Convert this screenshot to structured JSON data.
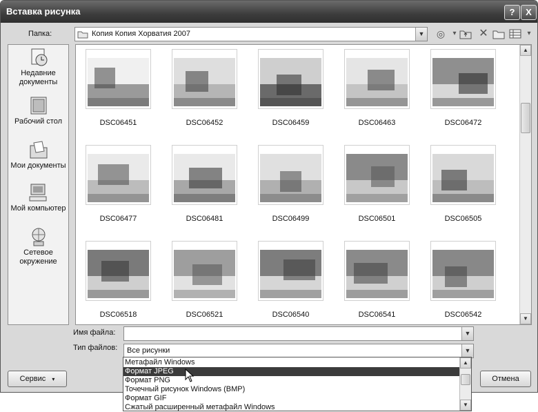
{
  "window": {
    "title": "Вставка рисунка",
    "help_button": "?",
    "close_button": "X"
  },
  "folder": {
    "label": "Папка:",
    "value": "Копия Копия Хорватия 2007"
  },
  "places": [
    {
      "id": "recent",
      "label": "Недавние документы",
      "icon": "recent-documents-icon"
    },
    {
      "id": "desktop",
      "label": "Рабочий стол",
      "icon": "desktop-icon"
    },
    {
      "id": "my-documents",
      "label": "Мои документы",
      "icon": "my-documents-icon"
    },
    {
      "id": "my-computer",
      "label": "Мой компьютер",
      "icon": "my-computer-icon"
    },
    {
      "id": "network",
      "label": "Сетевое окружение",
      "icon": "network-icon"
    }
  ],
  "thumbnails": [
    {
      "name": "DSC06451",
      "scene": "building"
    },
    {
      "name": "DSC06452",
      "scene": "square"
    },
    {
      "name": "DSC06459",
      "scene": "street"
    },
    {
      "name": "DSC06463",
      "scene": "square2"
    },
    {
      "name": "DSC06472",
      "scene": "coast"
    },
    {
      "name": "DSC06477",
      "scene": "building2"
    },
    {
      "name": "DSC06481",
      "scene": "people"
    },
    {
      "name": "DSC06499",
      "scene": "building3"
    },
    {
      "name": "DSC06501",
      "scene": "tower"
    },
    {
      "name": "DSC06505",
      "scene": "palms"
    },
    {
      "name": "DSC06518",
      "scene": "garden"
    },
    {
      "name": "DSC06521",
      "scene": "pier"
    },
    {
      "name": "DSC06540",
      "scene": "sea"
    },
    {
      "name": "DSC06541",
      "scene": "sea2"
    },
    {
      "name": "DSC06542",
      "scene": "sea3"
    }
  ],
  "filename": {
    "label": "Имя файла:",
    "value": ""
  },
  "filetype": {
    "label": "Тип файлов:",
    "value": "Все рисунки",
    "options": [
      "Метафайл Windows",
      "Формат JPEG",
      "Формат PNG",
      "Точечный рисунок Windows (BMP)",
      "Формат GIF",
      "Сжатый расширенный метафайл Windows"
    ],
    "highlighted_index": 1
  },
  "buttons": {
    "service": "Сервис",
    "cancel": "Отмена"
  }
}
